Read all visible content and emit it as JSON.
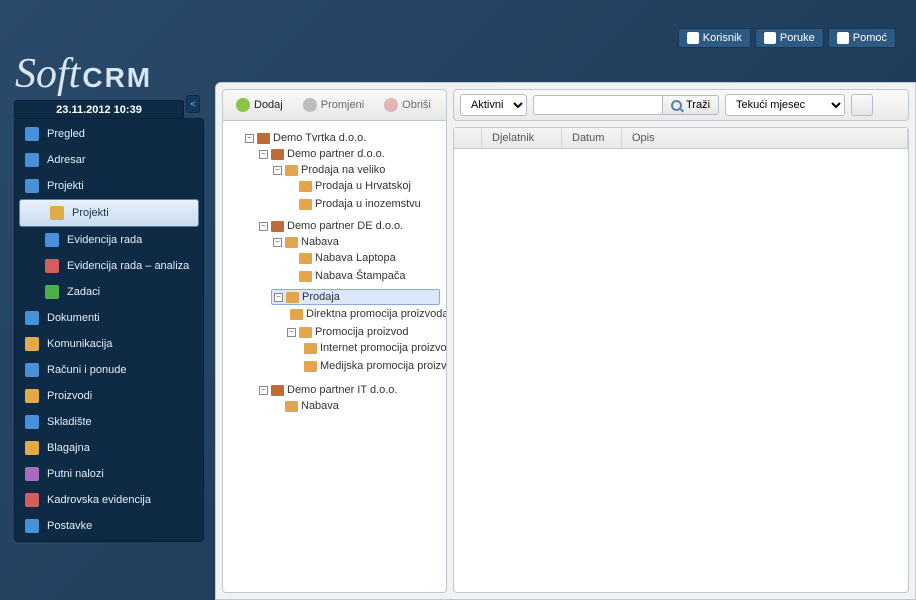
{
  "brand": {
    "soft": "Soft",
    "crm": "CRM"
  },
  "top_links": {
    "user": "Korisnik",
    "mail": "Poruke",
    "help": "Pomoć"
  },
  "datetime": "23.11.2012 10:39",
  "collapse_glyph": "<",
  "sidebar": {
    "items": [
      {
        "label": "Pregled",
        "cls": ""
      },
      {
        "label": "Adresar",
        "cls": ""
      },
      {
        "label": "Projekti",
        "cls": ""
      },
      {
        "label": "Projekti",
        "cls": "selected sub"
      },
      {
        "label": "Evidencija rada",
        "cls": "sub"
      },
      {
        "label": "Evidencija rada – analiza",
        "cls": "sub"
      },
      {
        "label": "Zadaci",
        "cls": "sub"
      },
      {
        "label": "Dokumenti",
        "cls": ""
      },
      {
        "label": "Komunikacija",
        "cls": ""
      },
      {
        "label": "Računi i ponude",
        "cls": ""
      },
      {
        "label": "Proizvodi",
        "cls": ""
      },
      {
        "label": "Skladište",
        "cls": ""
      },
      {
        "label": "Blagajna",
        "cls": ""
      },
      {
        "label": "Putni nalozi",
        "cls": ""
      },
      {
        "label": "Kadrovska evidencija",
        "cls": ""
      },
      {
        "label": "Postavke",
        "cls": ""
      }
    ]
  },
  "toolbar": {
    "add": "Dodaj",
    "edit": "Promjeni",
    "del": "Obriši"
  },
  "filter": {
    "status": "Aktivni",
    "search_btn": "Traži",
    "period": "Tekući mjesec"
  },
  "grid": {
    "cols": [
      "",
      "Djelatnik",
      "Datum",
      "Opis"
    ]
  },
  "tree": {
    "root": "Demo Tvrtka d.o.o.",
    "p1": "Demo partner d.o.o.",
    "p1a": "Prodaja na veliko",
    "p1a1": "Prodaja u Hrvatskoj",
    "p1a2": "Prodaja u inozemstvu",
    "p2": "Demo partner DE d.o.o.",
    "p2a": "Nabava",
    "p2a1": "Nabava Laptopa",
    "p2a2": "Nabava Štampača",
    "p2b": "Prodaja",
    "p2b1": "Direktna promocija proizvoda",
    "p2b2": "Promocija proizvod",
    "p2b2a": "Internet promocija proizvoda",
    "p2b2b": "Medijska promocija proizvoda",
    "p3": "Demo partner IT d.o.o.",
    "p3a": "Nabava"
  }
}
